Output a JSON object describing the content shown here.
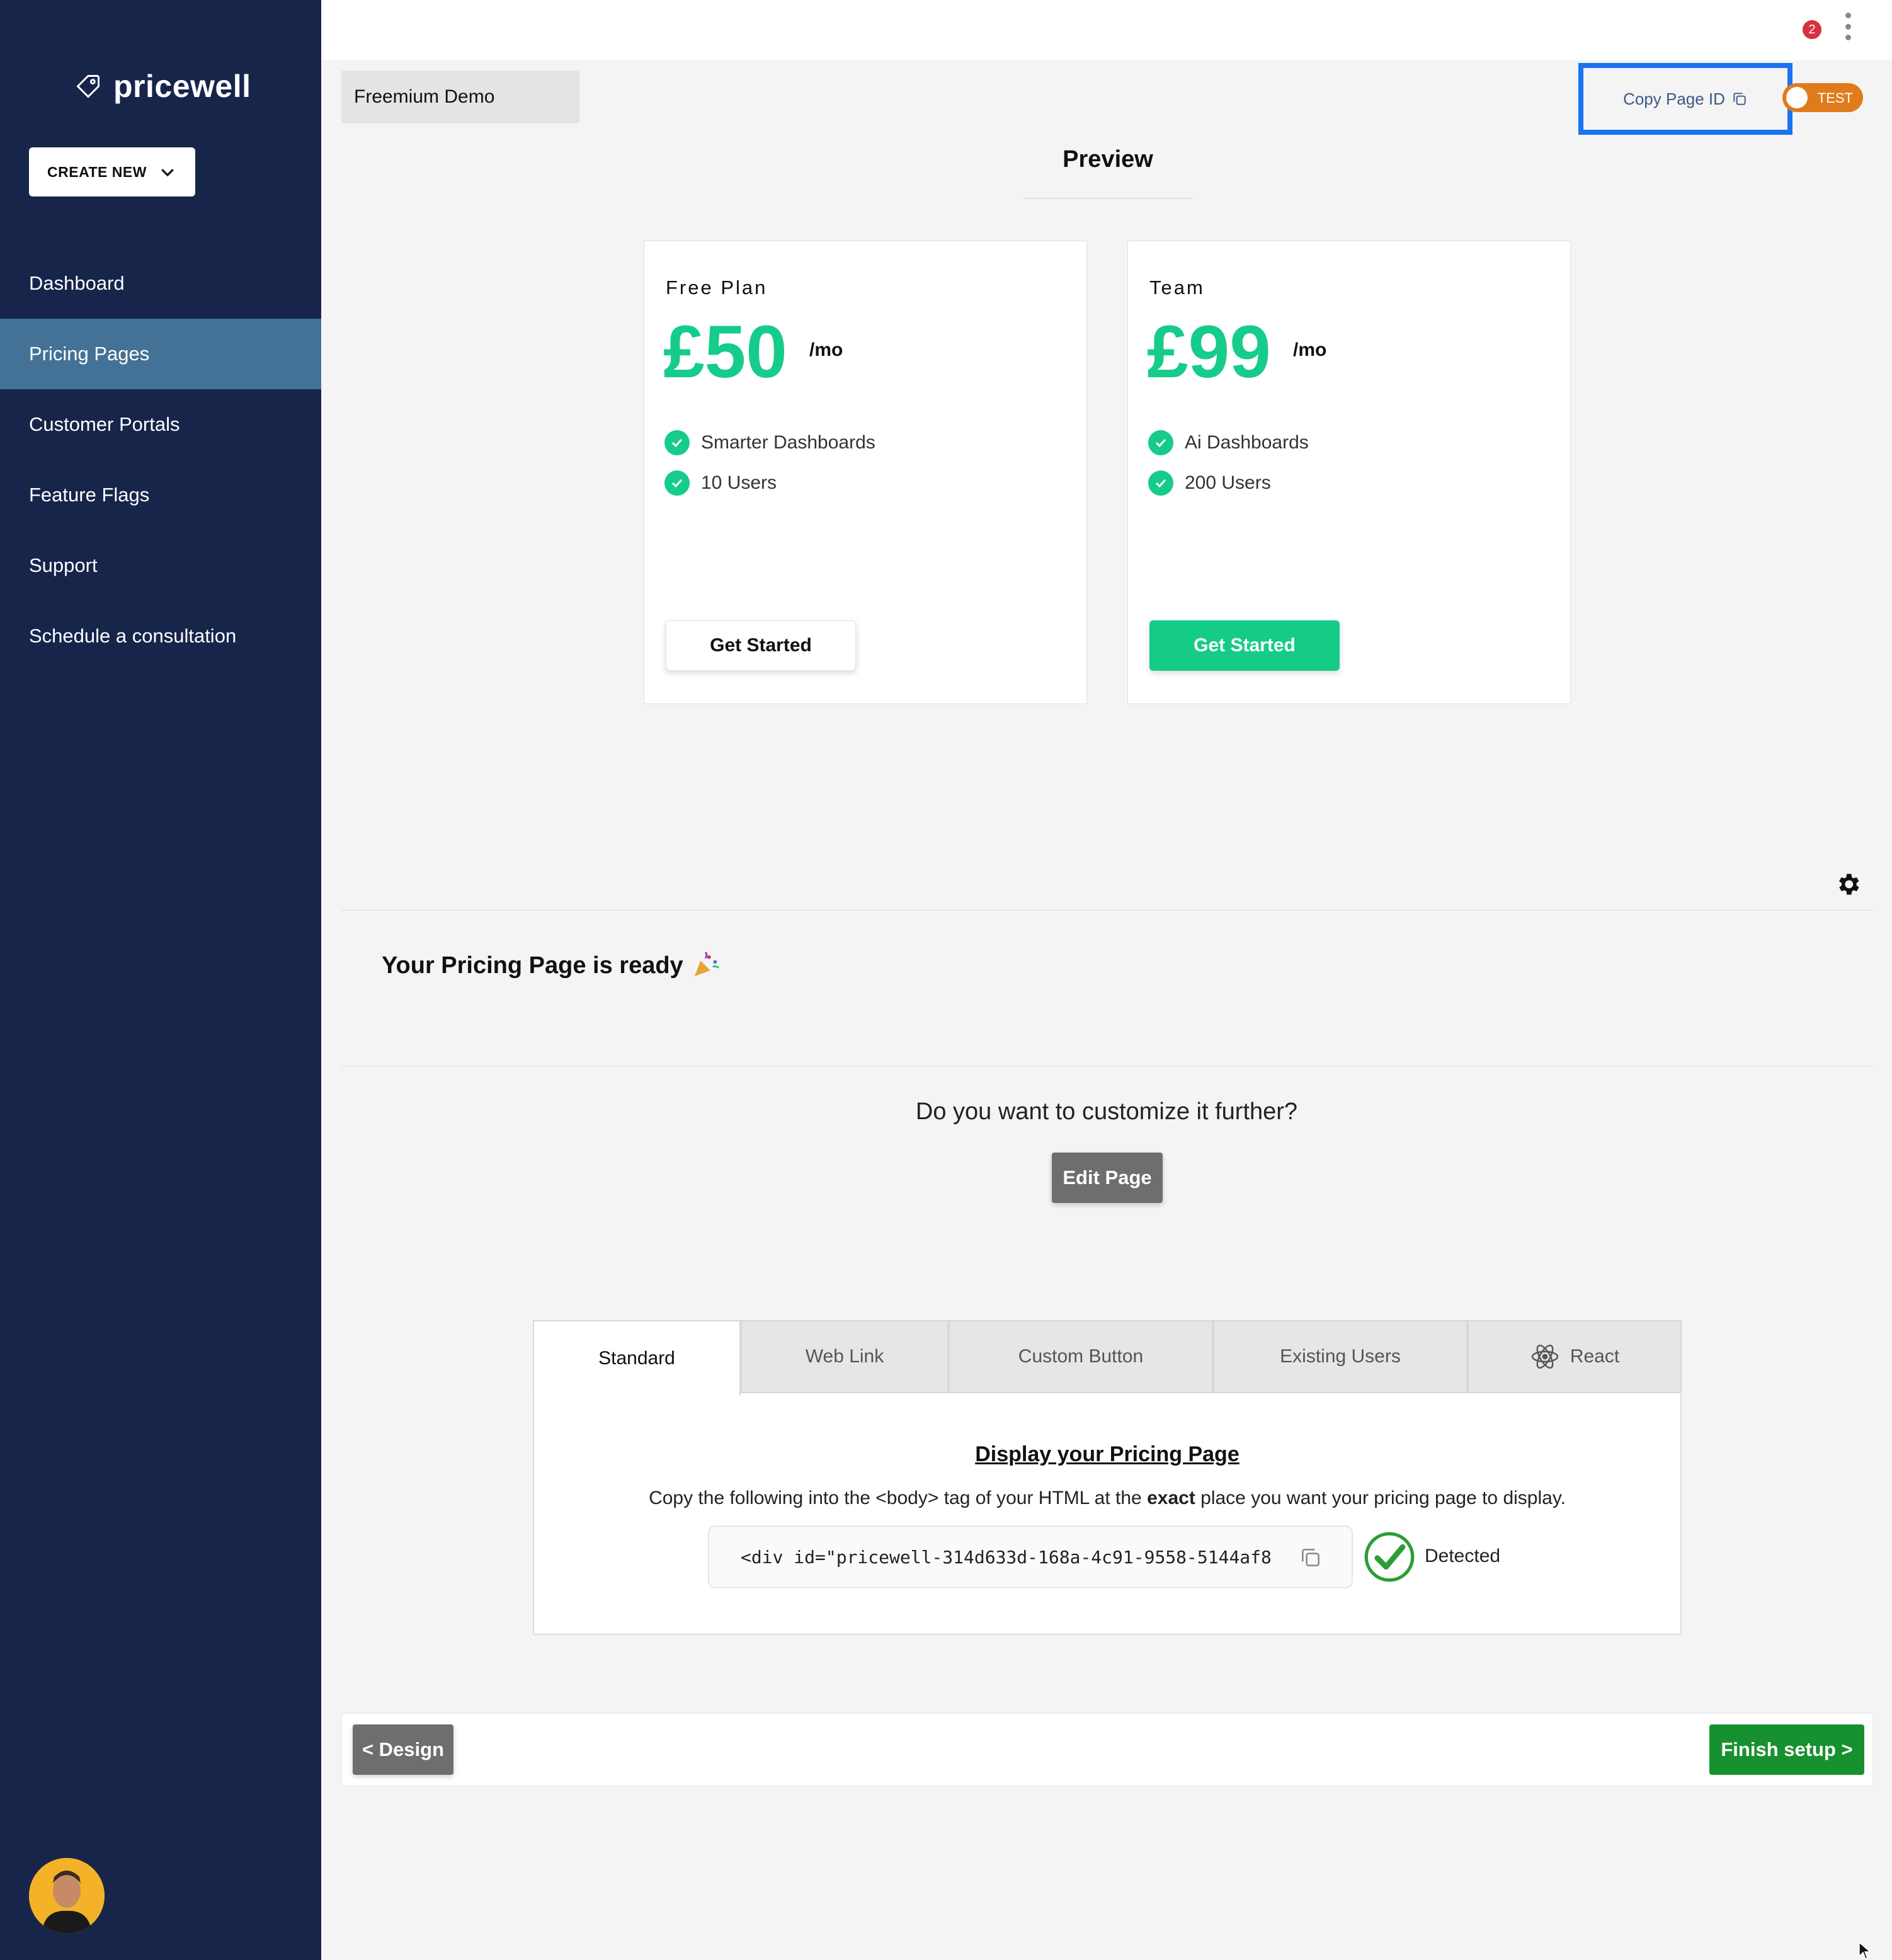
{
  "app": {
    "name": "pricewell",
    "notification_count": "2"
  },
  "sidebar": {
    "create_new_label": "CREATE NEW",
    "items": [
      {
        "label": "Dashboard",
        "active": false
      },
      {
        "label": "Pricing Pages",
        "active": true
      },
      {
        "label": "Customer Portals",
        "active": false
      },
      {
        "label": "Feature Flags",
        "active": false
      },
      {
        "label": "Support",
        "active": false
      },
      {
        "label": "Schedule a consultation",
        "active": false
      }
    ]
  },
  "header": {
    "page_name": "Freemium Demo",
    "copy_page_id_label": "Copy Page ID",
    "test_mode_label": "TEST"
  },
  "preview": {
    "title": "Preview",
    "plans": [
      {
        "name": "Free Plan",
        "price": "£50",
        "period": "/mo",
        "features": [
          "Smarter Dashboards",
          "10 Users"
        ],
        "button_label": "Get Started",
        "button_style": "outline"
      },
      {
        "name": "Team",
        "price": "£99",
        "period": "/mo",
        "features": [
          "Ai Dashboards",
          "200 Users"
        ],
        "button_label": "Get Started",
        "button_style": "filled"
      }
    ]
  },
  "ready": {
    "title": "Your Pricing Page is ready"
  },
  "customize": {
    "question": "Do you want to customize it further?",
    "edit_button_label": "Edit Page"
  },
  "embed": {
    "tabs": [
      {
        "label": "Standard",
        "active": true
      },
      {
        "label": "Web Link",
        "active": false
      },
      {
        "label": "Custom Button",
        "active": false
      },
      {
        "label": "Existing Users",
        "active": false
      },
      {
        "label": "React",
        "active": false,
        "icon": "react-icon"
      }
    ],
    "display_title": "Display your Pricing Page",
    "instructions_before": "Copy the following into the <body> tag of your HTML at the ",
    "instructions_bold": "exact",
    "instructions_after": " place you want your pricing page to display.",
    "code_snippet": "<div id=\"pricewell-314d633d-168a-4c91-9558-5144af8",
    "status_label": "Detected"
  },
  "footer": {
    "back_label": "< Design",
    "finish_label": "Finish setup >"
  },
  "colors": {
    "sidebar": "#17254a",
    "active_nav": "#447296",
    "accent_green": "#16cc8a",
    "finish_green": "#17912f",
    "highlight_blue": "#1a73f0",
    "test_orange": "#e07b1c"
  }
}
